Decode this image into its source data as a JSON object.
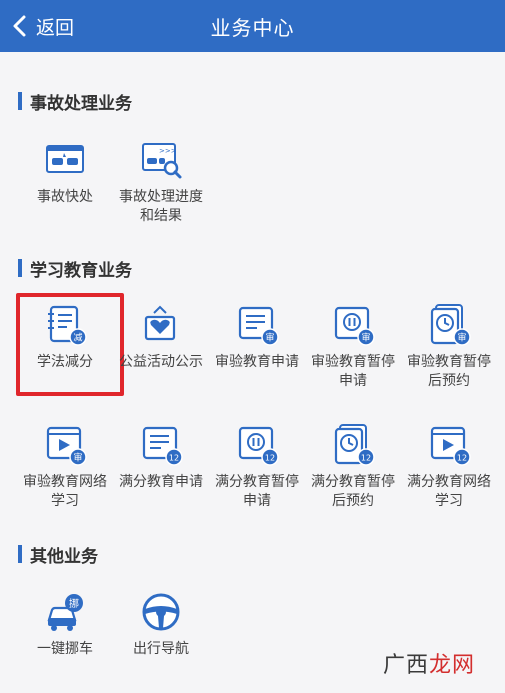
{
  "header": {
    "back_label": "返回",
    "title": "业务中心"
  },
  "sections": [
    {
      "title": "事故处理业务"
    },
    {
      "title": "学习教育业务"
    },
    {
      "title": "其他业务"
    }
  ],
  "accident": [
    {
      "label": "事故快处",
      "icon": "accident-car-icon"
    },
    {
      "label": "事故处理进度和结果",
      "icon": "accident-search-icon"
    }
  ],
  "study": [
    {
      "label": "学法减分",
      "icon": "study-deduct-icon",
      "badge": "减"
    },
    {
      "label": "公益活动公示",
      "icon": "heart-hands-icon"
    },
    {
      "label": "审验教育申请",
      "icon": "review-doc-icon",
      "badge": "审"
    },
    {
      "label": "审验教育暂停申请",
      "icon": "review-pause-icon",
      "badge": "审"
    },
    {
      "label": "审验教育暂停后预约",
      "icon": "review-clock-icon",
      "badge": "审"
    },
    {
      "label": "审验教育网络学习",
      "icon": "review-video-icon",
      "badge": "审"
    },
    {
      "label": "满分教育申请",
      "icon": "full-score-doc-icon",
      "badge": "12"
    },
    {
      "label": "满分教育暂停申请",
      "icon": "full-score-pause-icon",
      "badge": "12"
    },
    {
      "label": "满分教育暂停后预约",
      "icon": "full-score-clock-icon",
      "badge": "12"
    },
    {
      "label": "满分教育网络学习",
      "icon": "full-score-video-icon",
      "badge": "12"
    }
  ],
  "other": [
    {
      "label": "一键挪车",
      "icon": "move-car-icon",
      "badge": "挪"
    },
    {
      "label": "出行导航",
      "icon": "steering-wheel-icon"
    }
  ],
  "watermark": {
    "text": "广西",
    "accent": "龙网"
  },
  "colors": {
    "header": "#2f6cc4",
    "accent": "#2f6cc4",
    "highlight": "#e0262c"
  }
}
